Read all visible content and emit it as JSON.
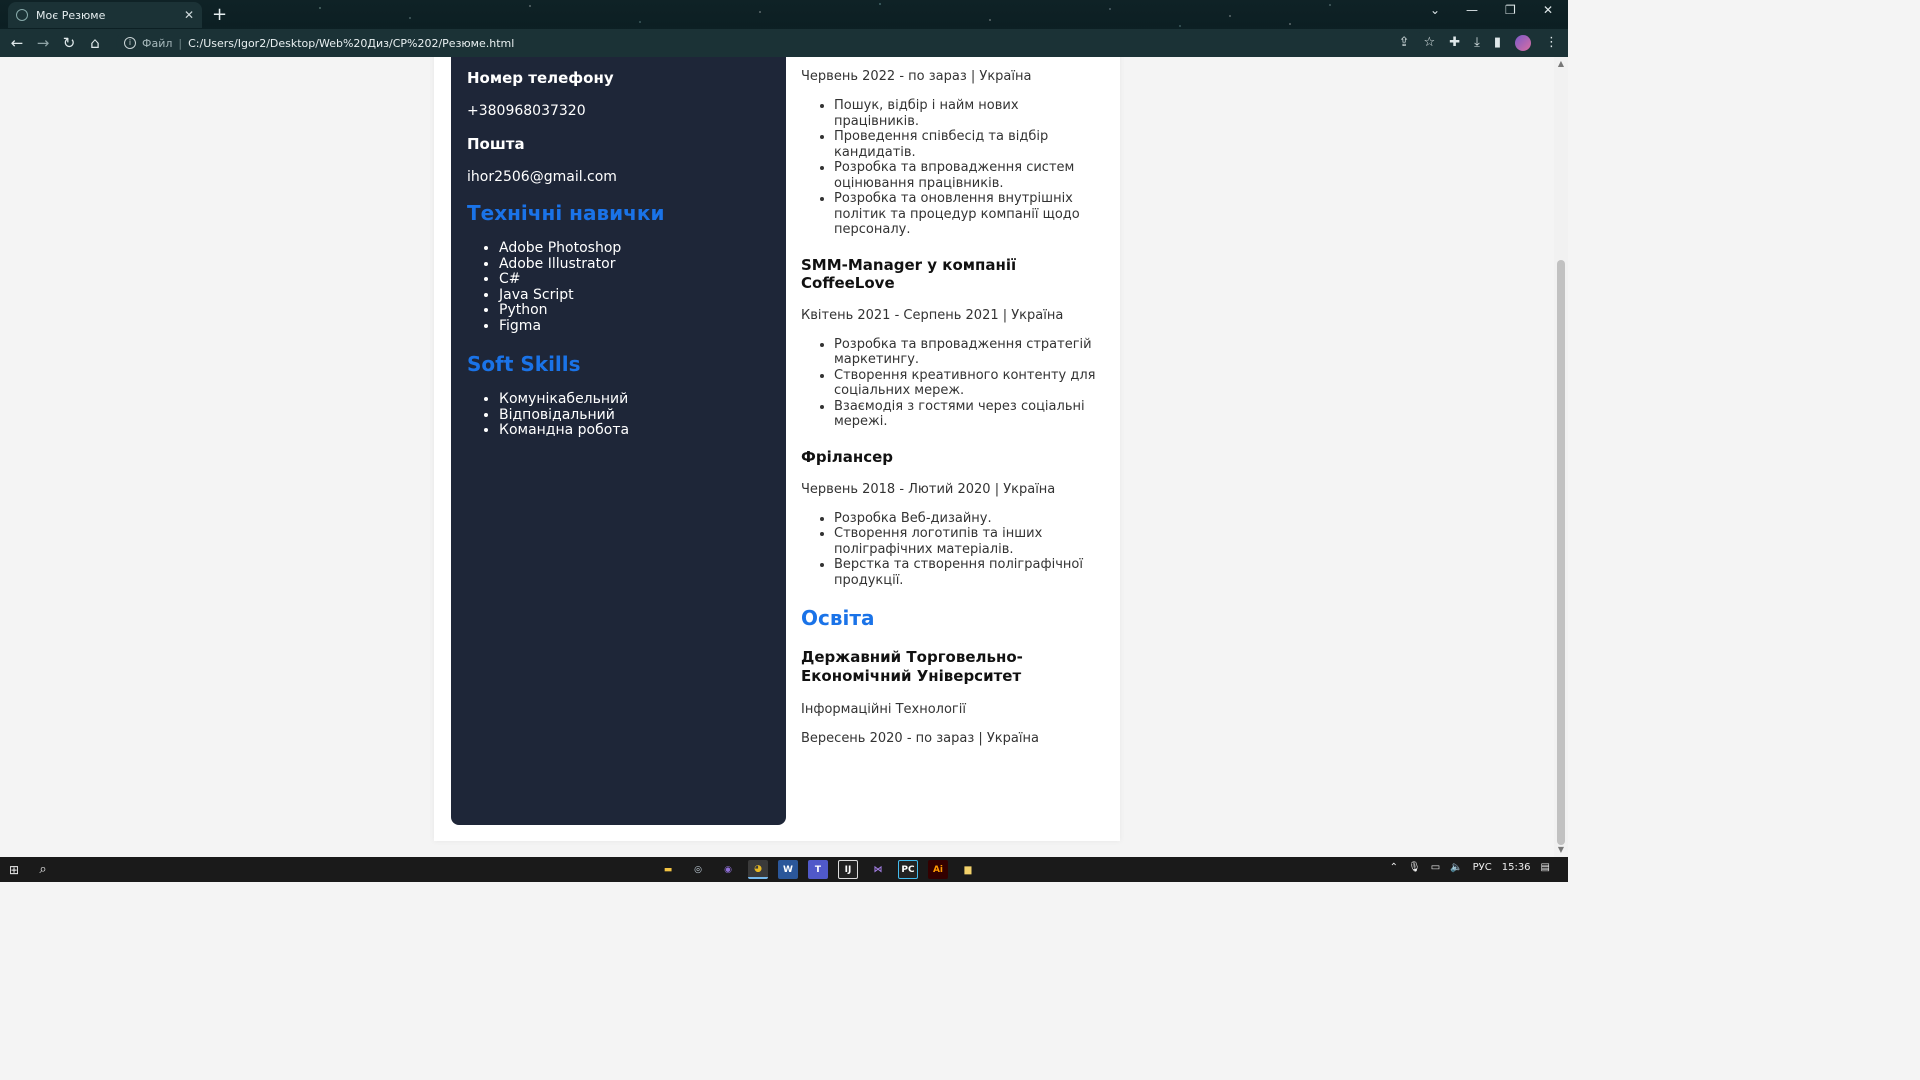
{
  "browser": {
    "tab_title": "Моє Резюме",
    "url_scheme": "Файл",
    "url": "C:/Users/Igor2/Desktop/Web%20Диз/СР%202/Резюме.html"
  },
  "sidebar": {
    "phone_heading": "Номер телефону",
    "phone": "+380968037320",
    "email_heading": "Пошта",
    "email": "ihor2506@gmail.com",
    "tech_heading": "Технічні навички",
    "tech_skills": [
      "Adobe Photoshop",
      "Adobe Illustrator",
      "C#",
      "Java Script",
      "Python",
      "Figma"
    ],
    "soft_heading": "Soft Skills",
    "soft_skills": [
      "Комунікабельний",
      "Відповідальний",
      "Командна робота"
    ]
  },
  "experience": [
    {
      "title": "",
      "date": "Червень 2022 - по зараз | Україна",
      "duties": [
        "Пошук, відбір і найм нових працівників.",
        "Проведення співбесід та відбір кандидатів.",
        "Розробка та впровадження систем оцінювання працівників.",
        "Розробка та оновлення внутрішніх політик та процедур компанії щодо персоналу."
      ]
    },
    {
      "title": "SMM-Manager у компанії CoffeeLove",
      "date": "Квітень 2021 - Серпень 2021 | Україна",
      "duties": [
        "Розробка та впровадження стратегій маркетингу.",
        "Створення креативного контенту для соціальних мереж.",
        "Взаємодія з гостями через соціальні мережі."
      ]
    },
    {
      "title": "Фрілансер",
      "date": "Червень 2018 - Лютий 2020 | Україна",
      "duties": [
        "Розробка Веб-дизайну.",
        "Створення логотипів та інших поліграфічних матеріалів.",
        "Верстка та створення поліграфічної продукції."
      ]
    }
  ],
  "education": {
    "heading": "Освіта",
    "institution": "Державний Торговельно-Економічний Університет",
    "field": "Інформаційні Технології",
    "date": "Вересень 2020 - по зараз | Україна"
  },
  "taskbar": {
    "lang": "РУС",
    "time": "15:36"
  },
  "colors": {
    "sidebar_bg": "#1e2638",
    "accent": "#1a73e8"
  }
}
